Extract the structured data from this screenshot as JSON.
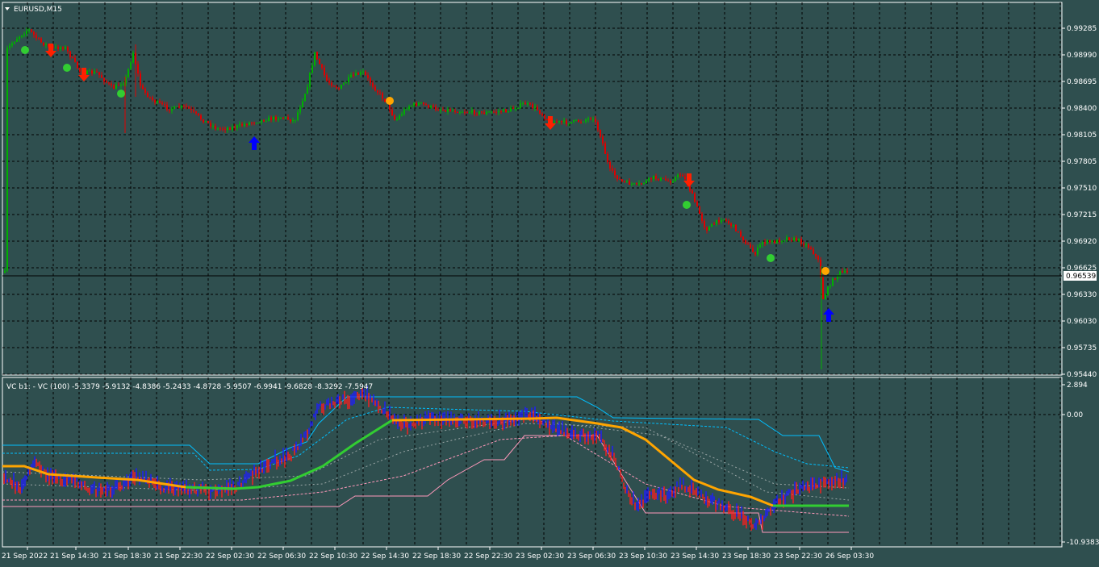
{
  "chart": {
    "symbol_title": "EURUSD,M15",
    "indicator_title": "VC b1: - VC (100) -5.3379 -5.9132 -4.8386 -5.2433 -4.8728 -5.9507 -6.9941 -9.6828 -8.3292 -7.5947",
    "current_price_label": "0.96539",
    "price_ticks": [
      "0.99285",
      "0.98990",
      "0.98695",
      "0.98400",
      "0.98105",
      "0.97805",
      "0.97510",
      "0.97215",
      "0.96920",
      "0.96625",
      "0.96330",
      "0.96030",
      "0.95735",
      "0.95440"
    ],
    "indicator_ticks": [
      "2.894",
      "0.00",
      "-10.9383"
    ],
    "time_ticks": [
      "21 Sep 2022",
      "21 Sep 14:30",
      "21 Sep 18:30",
      "21 Sep 22:30",
      "22 Sep 02:30",
      "22 Sep 06:30",
      "22 Sep 10:30",
      "22 Sep 14:30",
      "22 Sep 18:30",
      "22 Sep 22:30",
      "23 Sep 02:30",
      "23 Sep 06:30",
      "23 Sep 10:30",
      "23 Sep 14:30",
      "23 Sep 18:30",
      "23 Sep 22:30",
      "26 Sep 03:30"
    ],
    "colors": {
      "background": "#2f4f4f",
      "grid": "#000000",
      "bull": "#00b000",
      "bear": "#e00000",
      "signal_up": "#0000ff",
      "signal_down": "#ff2000",
      "dot_green": "#32cd32",
      "dot_orange": "#ffa500",
      "vc_blue": "#1e1eff",
      "vc_red": "#ff1e1e",
      "vc_orange_line": "#ffa500",
      "vc_green_line": "#32cd32",
      "band_cyan": "#00bfff",
      "band_pink": "#ff99bb"
    }
  },
  "chart_data": {
    "type": "line",
    "series": [
      {
        "name": "",
        "x": [
          "21 Sep 2022",
          "21 Sep 14:30",
          "21 Sep 18:30",
          "21 Sep 22:30",
          "22 Sep 02:30",
          "22 Sep 06:30",
          "22 Sep 10:30",
          "22 Sep 14:30",
          "22 Sep 18:30",
          "22 Sep 22:30",
          "23 Sep 02:30",
          "23 Sep 06:30",
          "23 Sep 10:30",
          "23 Sep 14:30",
          "23 Sep 18:30",
          "23 Sep 22:30",
          "26 Sep 03:30"
        ],
        "values": [
          0.991,
          0.988,
          0.9855,
          0.9842,
          0.9815,
          0.9828,
          0.9875,
          0.9825,
          0.984,
          0.9835,
          0.9835,
          0.9825,
          0.9755,
          0.976,
          0.968,
          0.9695,
          0.9655
        ]
      }
    ],
    "ylim": [
      0.9544,
      0.994
    ]
  }
}
